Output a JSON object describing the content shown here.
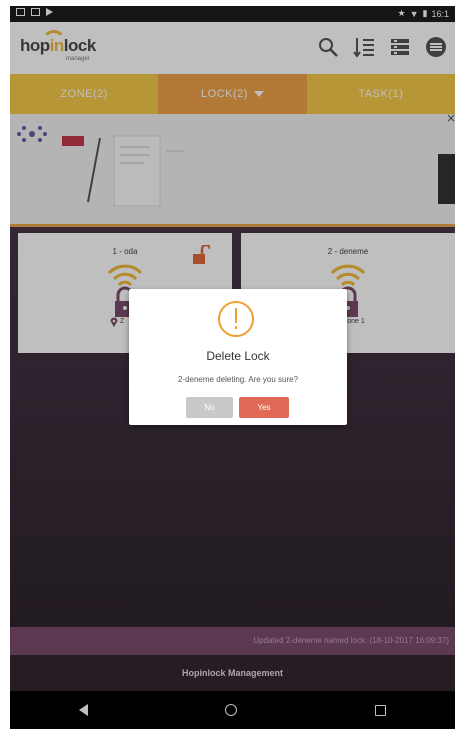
{
  "status": {
    "time": "16:1"
  },
  "app": {
    "logo_left": "hop",
    "logo_in": "in",
    "logo_right": "lock",
    "logo_sub": "manager"
  },
  "tabs": [
    {
      "label": "ZONE(2)"
    },
    {
      "label": "LOCK(2)"
    },
    {
      "label": "TASK(1)"
    }
  ],
  "locks": [
    {
      "name": "1 - oda",
      "zone": "Z"
    },
    {
      "name": "2 - deneme",
      "zone": "Zone 1"
    }
  ],
  "dialog": {
    "title": "Delete Lock",
    "message": "2-deneme deleting. Are you sure?",
    "no_label": "No",
    "yes_label": "Yes"
  },
  "update_text": "Updated 2-deneme named lock. (18-10-2017 16:09:37)",
  "footer": "Hopinlock Management",
  "colors": {
    "accent": "#f5c84a",
    "tab_active": "#eea24a",
    "danger": "#e06a55",
    "warning": "#f0a030"
  }
}
